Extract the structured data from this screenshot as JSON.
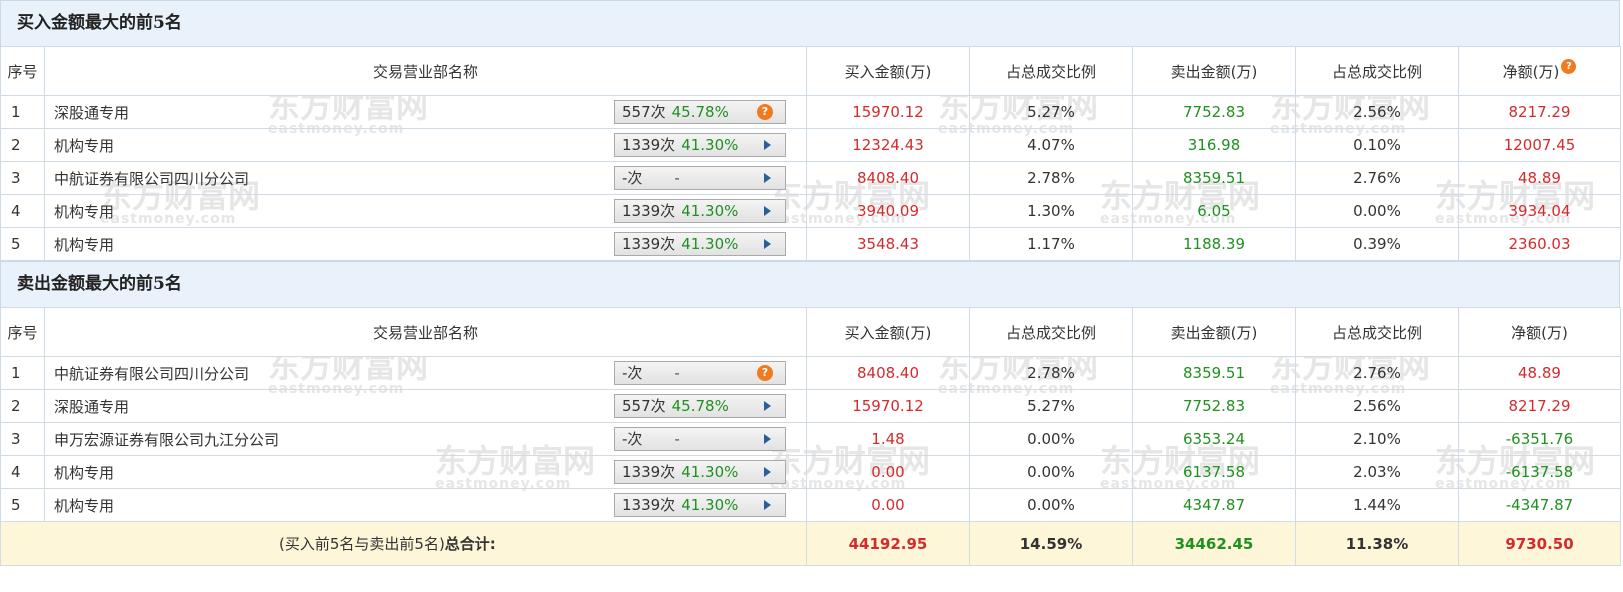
{
  "buy_section": {
    "title": "买入金额最大的前5名",
    "headers": [
      "序号",
      "交易营业部名称",
      "买入金额(万)",
      "占总成交比例",
      "卖出金额(万)",
      "占总成交比例",
      "净额(万)"
    ],
    "net_help_icon": "question-icon",
    "rows": [
      {
        "seq": "1",
        "name": "深股通专用",
        "count": "557次",
        "pct": "45.78%",
        "action": "question-icon",
        "buy": "15970.12",
        "buy_pct": "5.27%",
        "sell": "7752.83",
        "sell_pct": "2.56%",
        "net": "8217.29"
      },
      {
        "seq": "2",
        "name": "机构专用",
        "count": "1339次",
        "pct": "41.30%",
        "action": "play-arrow-icon",
        "buy": "12324.43",
        "buy_pct": "4.07%",
        "sell": "316.98",
        "sell_pct": "0.10%",
        "net": "12007.45"
      },
      {
        "seq": "3",
        "name": "中航证券有限公司四川分公司",
        "count": "-次",
        "pct": "-",
        "action": "play-arrow-icon",
        "buy": "8408.40",
        "buy_pct": "2.78%",
        "sell": "8359.51",
        "sell_pct": "2.76%",
        "net": "48.89"
      },
      {
        "seq": "4",
        "name": "机构专用",
        "count": "1339次",
        "pct": "41.30%",
        "action": "play-arrow-icon",
        "buy": "3940.09",
        "buy_pct": "1.30%",
        "sell": "6.05",
        "sell_pct": "0.00%",
        "net": "3934.04"
      },
      {
        "seq": "5",
        "name": "机构专用",
        "count": "1339次",
        "pct": "41.30%",
        "action": "play-arrow-icon",
        "buy": "3548.43",
        "buy_pct": "1.17%",
        "sell": "1188.39",
        "sell_pct": "0.39%",
        "net": "2360.03"
      }
    ]
  },
  "sell_section": {
    "title": "卖出金额最大的前5名",
    "headers": [
      "序号",
      "交易营业部名称",
      "买入金额(万)",
      "占总成交比例",
      "卖出金额(万)",
      "占总成交比例",
      "净额(万)"
    ],
    "rows": [
      {
        "seq": "1",
        "name": "中航证券有限公司四川分公司",
        "count": "-次",
        "pct": "-",
        "action": "question-icon",
        "buy": "8408.40",
        "buy_pct": "2.78%",
        "sell": "8359.51",
        "sell_pct": "2.76%",
        "net": "48.89"
      },
      {
        "seq": "2",
        "name": "深股通专用",
        "count": "557次",
        "pct": "45.78%",
        "action": "play-arrow-icon",
        "buy": "15970.12",
        "buy_pct": "5.27%",
        "sell": "7752.83",
        "sell_pct": "2.56%",
        "net": "8217.29"
      },
      {
        "seq": "3",
        "name": "申万宏源证券有限公司九江分公司",
        "count": "-次",
        "pct": "-",
        "action": "play-arrow-icon",
        "buy": "1.48",
        "buy_pct": "0.00%",
        "sell": "6353.24",
        "sell_pct": "2.10%",
        "net": "-6351.76"
      },
      {
        "seq": "4",
        "name": "机构专用",
        "count": "1339次",
        "pct": "41.30%",
        "action": "play-arrow-icon",
        "buy": "0.00",
        "buy_pct": "0.00%",
        "sell": "6137.58",
        "sell_pct": "2.03%",
        "net": "-6137.58"
      },
      {
        "seq": "5",
        "name": "机构专用",
        "count": "1339次",
        "pct": "41.30%",
        "action": "play-arrow-icon",
        "buy": "0.00",
        "buy_pct": "0.00%",
        "sell": "4347.87",
        "sell_pct": "1.44%",
        "net": "-4347.87"
      }
    ]
  },
  "total": {
    "label_prefix": "(买入前5名与卖出前5名)",
    "label_bold": "总合计:",
    "buy": "44192.95",
    "buy_pct": "14.59%",
    "sell": "34462.45",
    "sell_pct": "11.38%",
    "net": "9730.50"
  },
  "watermark": {
    "text": "东方财富网",
    "sub": "eastmoney.com"
  },
  "colors": {
    "buy": "#d42b2b",
    "sell": "#209020",
    "net_positive": "#d42b2b",
    "net_negative": "#209020",
    "section_header_bg": "#e9f2fb",
    "total_row_bg": "#fdf6d8"
  }
}
